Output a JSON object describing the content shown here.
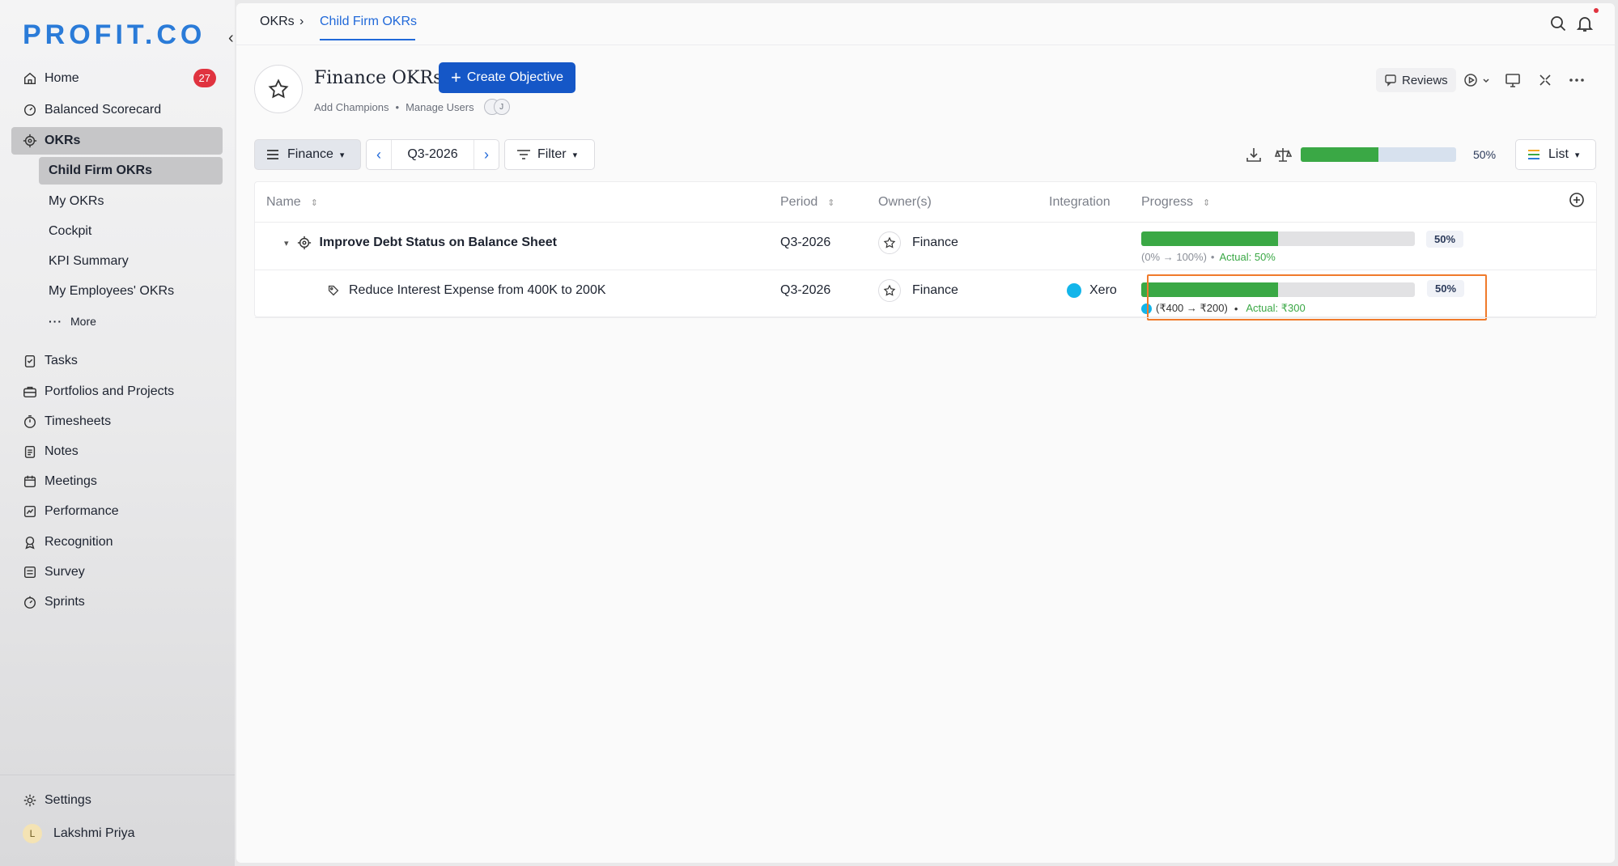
{
  "brand": {
    "logo_text": "PROFIT.CO",
    "color": "#2a7bd8"
  },
  "sidebar": {
    "items": [
      {
        "label": "Home",
        "icon": "home-icon",
        "badge": "27"
      },
      {
        "label": "Balanced Scorecard",
        "icon": "scorecard-icon"
      },
      {
        "label": "OKRs",
        "icon": "target-icon",
        "active": true
      },
      {
        "label": "Tasks",
        "icon": "tasks-icon"
      },
      {
        "label": "Portfolios and Projects",
        "icon": "briefcase-icon"
      },
      {
        "label": "Timesheets",
        "icon": "stopwatch-icon"
      },
      {
        "label": "Notes",
        "icon": "notes-icon"
      },
      {
        "label": "Meetings",
        "icon": "calendar-icon"
      },
      {
        "label": "Performance",
        "icon": "chart-icon"
      },
      {
        "label": "Recognition",
        "icon": "award-icon"
      },
      {
        "label": "Survey",
        "icon": "survey-icon"
      },
      {
        "label": "Sprints",
        "icon": "sprint-icon"
      }
    ],
    "okr_sub": [
      {
        "label": "Child Firm OKRs",
        "active": true
      },
      {
        "label": "My OKRs"
      },
      {
        "label": "Cockpit"
      },
      {
        "label": "KPI Summary"
      },
      {
        "label": "My Employees' OKRs"
      },
      {
        "label": "More"
      }
    ],
    "settings_label": "Settings",
    "user": {
      "initial": "L",
      "name": "Lakshmi Priya"
    }
  },
  "breadcrumb": {
    "root": "OKRs",
    "sep": "›",
    "current": "Child Firm OKRs"
  },
  "header": {
    "title": "Finance OKRs",
    "create_label": "Create Objective",
    "add_champions": "Add Champions",
    "dot": "•",
    "manage_users": "Manage Users",
    "avatar_initial": "J",
    "reviews_label": "Reviews"
  },
  "toolbar": {
    "team": "Finance",
    "period": "Q3-2026",
    "filter": "Filter",
    "overall_progress": 50,
    "overall_progress_label": "50%",
    "view": "List"
  },
  "table": {
    "columns": {
      "name": "Name",
      "period": "Period",
      "owners": "Owner(s)",
      "integration": "Integration",
      "progress": "Progress"
    },
    "rows": [
      {
        "name": "Improve Debt Status on Balance Sheet",
        "period": "Q3-2026",
        "owner": "Finance",
        "integration": "",
        "progress": 50,
        "progress_label": "50%",
        "range": "(0% → 100%)",
        "bullet": "•",
        "actual": "Actual: 50%"
      },
      {
        "name": "Reduce Interest Expense from 400K to 200K",
        "period": "Q3-2026",
        "owner": "Finance",
        "integration": "Xero",
        "progress": 50,
        "progress_label": "50%",
        "range": "(₹400 → ₹200)",
        "bullet": "•",
        "actual": "Actual: ₹300"
      }
    ]
  },
  "colors": {
    "accent": "#1557c7",
    "progress": "#3aa845",
    "highlight": "#f07a2b",
    "badge": "#e0333f",
    "xero": "#13b5ea"
  }
}
